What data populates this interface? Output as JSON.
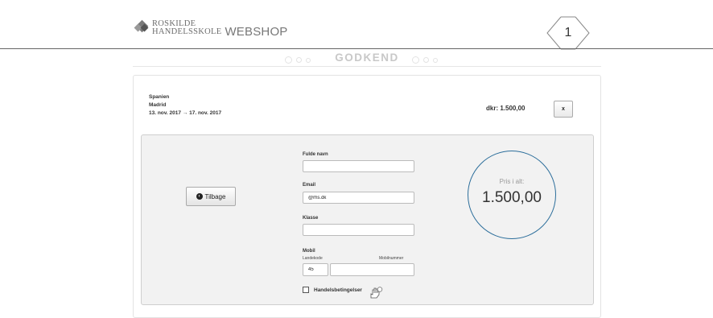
{
  "header": {
    "logo_line1": "ROSKILDE",
    "logo_line2": "HANDELSSKOLE",
    "shop_name": "WEBSHOP",
    "cart_count": "1"
  },
  "step": {
    "title": "GODKEND"
  },
  "order": {
    "country": "Spanien",
    "city": "Madrid",
    "dates": "13. nov. 2017 → 17. nov. 2017",
    "price": "dkr: 1.500,00",
    "remove_label": "x"
  },
  "form": {
    "back_label": "Tilbage",
    "fullname_label": "Fulde navn",
    "fullname_value": "",
    "email_label": "Email",
    "email_value": "@rhs.dk",
    "class_label": "Klasse",
    "class_value": "",
    "mobile_label": "Mobil",
    "country_code_label": "Landekode",
    "country_code_value": "45",
    "mobile_number_label": "Mobilnummer",
    "mobile_number_value": "",
    "terms_label": "Handelsbetingelser",
    "terms_checked": false
  },
  "total": {
    "label": "Pris i alt:",
    "value": "1.500,00"
  },
  "colors": {
    "accent_circle": "#2c6e9b",
    "step_title": "#c8c8c8"
  }
}
